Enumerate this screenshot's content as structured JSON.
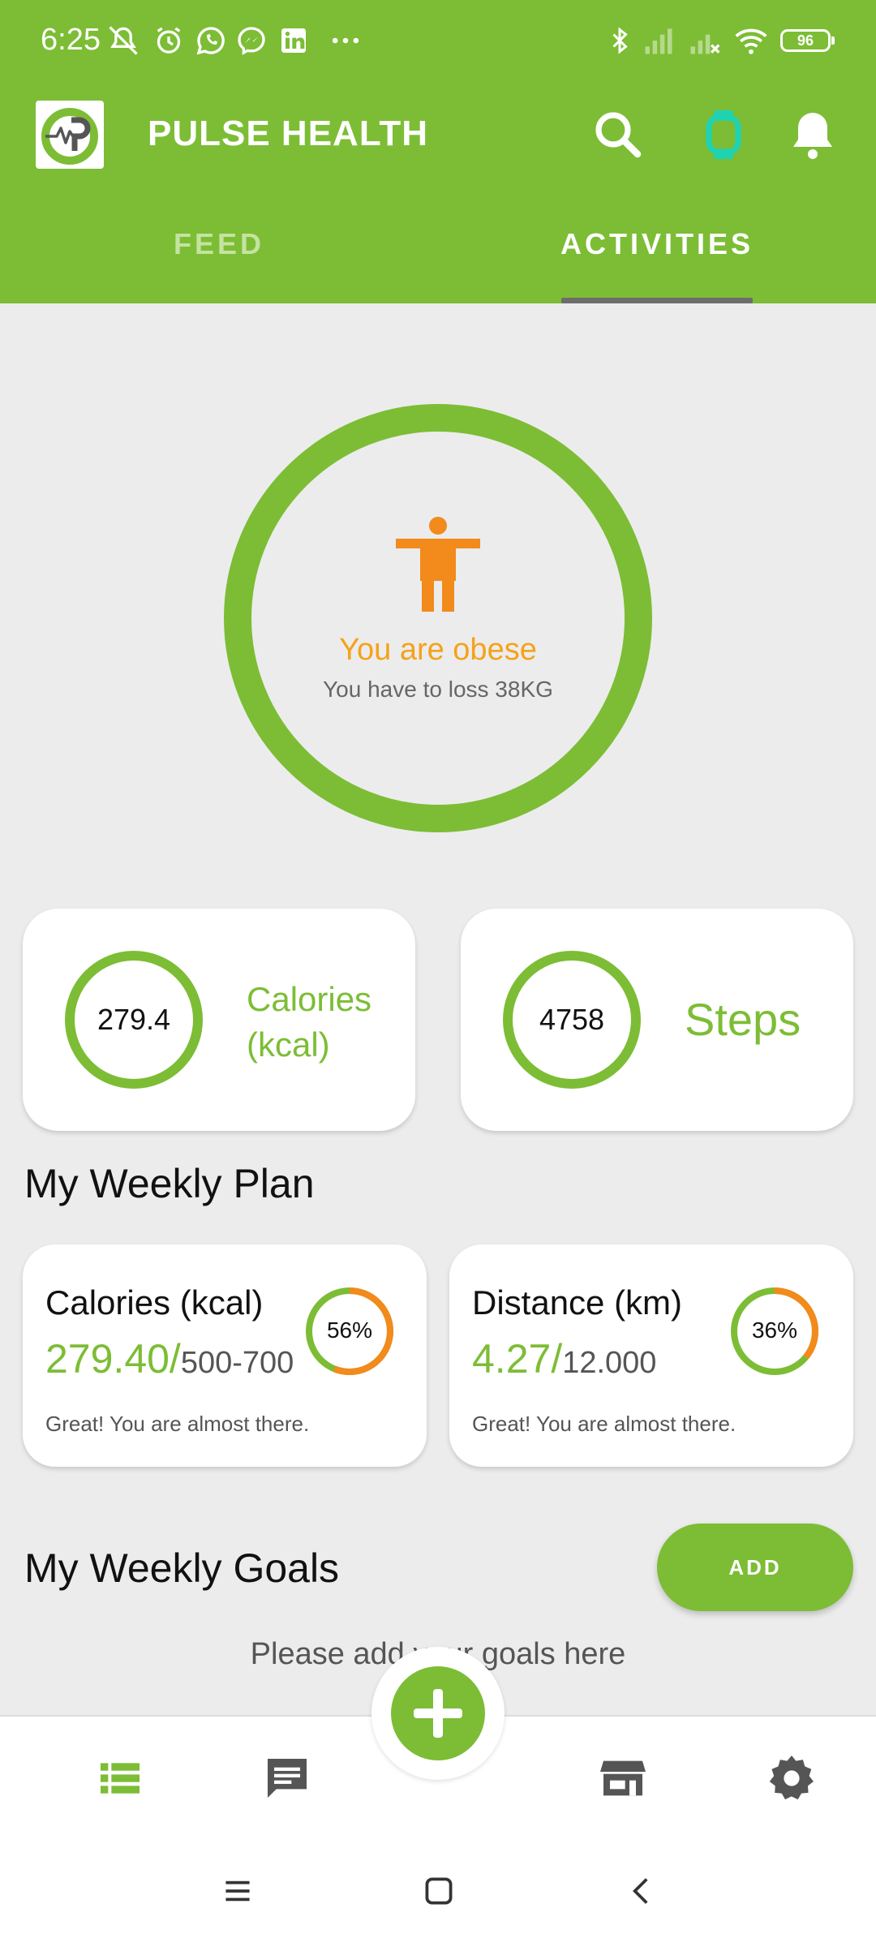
{
  "status_bar": {
    "time": "6:25",
    "battery": "96",
    "icons": [
      "mute-icon",
      "alarm-icon",
      "whatsapp-icon",
      "messenger-icon",
      "linkedin-icon",
      "more-dots-icon",
      "bluetooth-icon",
      "signal-icon",
      "signal-off-icon",
      "wifi-icon",
      "battery-icon"
    ]
  },
  "app_bar": {
    "title": "PULSE HEALTH",
    "icons": [
      "app-logo-icon",
      "search-icon",
      "smartwatch-icon",
      "bell-icon"
    ]
  },
  "tabs": [
    {
      "label": "FEED",
      "selected": false
    },
    {
      "label": "ACTIVITIES",
      "selected": true
    }
  ],
  "bmi": {
    "status": "You are obese",
    "message": "You have to loss 38KG"
  },
  "stats": {
    "calories": {
      "value": "279.4",
      "label": "Calories\n(kcal)"
    },
    "steps": {
      "value": "4758",
      "label": "Steps"
    }
  },
  "weekly_plan": {
    "title": "My Weekly Plan",
    "cards": [
      {
        "title": "Calories (kcal)",
        "current": "279.40/",
        "target": "500-700",
        "percent_label": "56%",
        "percent": 56,
        "note": "Great! You are almost there."
      },
      {
        "title": "Distance (km)",
        "current": "4.27/",
        "target": "12.000",
        "percent_label": "36%",
        "percent": 36,
        "note": "Great! You are almost there."
      }
    ]
  },
  "weekly_goals": {
    "title": "My Weekly Goals",
    "add_label": "ADD",
    "empty_text": "Please add your goals here"
  },
  "bottom_nav": [
    "list-icon",
    "chat-icon",
    "add-icon",
    "store-icon",
    "settings-icon"
  ],
  "system_nav": [
    "menu-icon",
    "home-icon",
    "back-icon"
  ],
  "colors": {
    "primary": "#7cbd35",
    "accent": "#f28a1c",
    "warning_text": "#f5a21b",
    "background": "#ececec"
  }
}
